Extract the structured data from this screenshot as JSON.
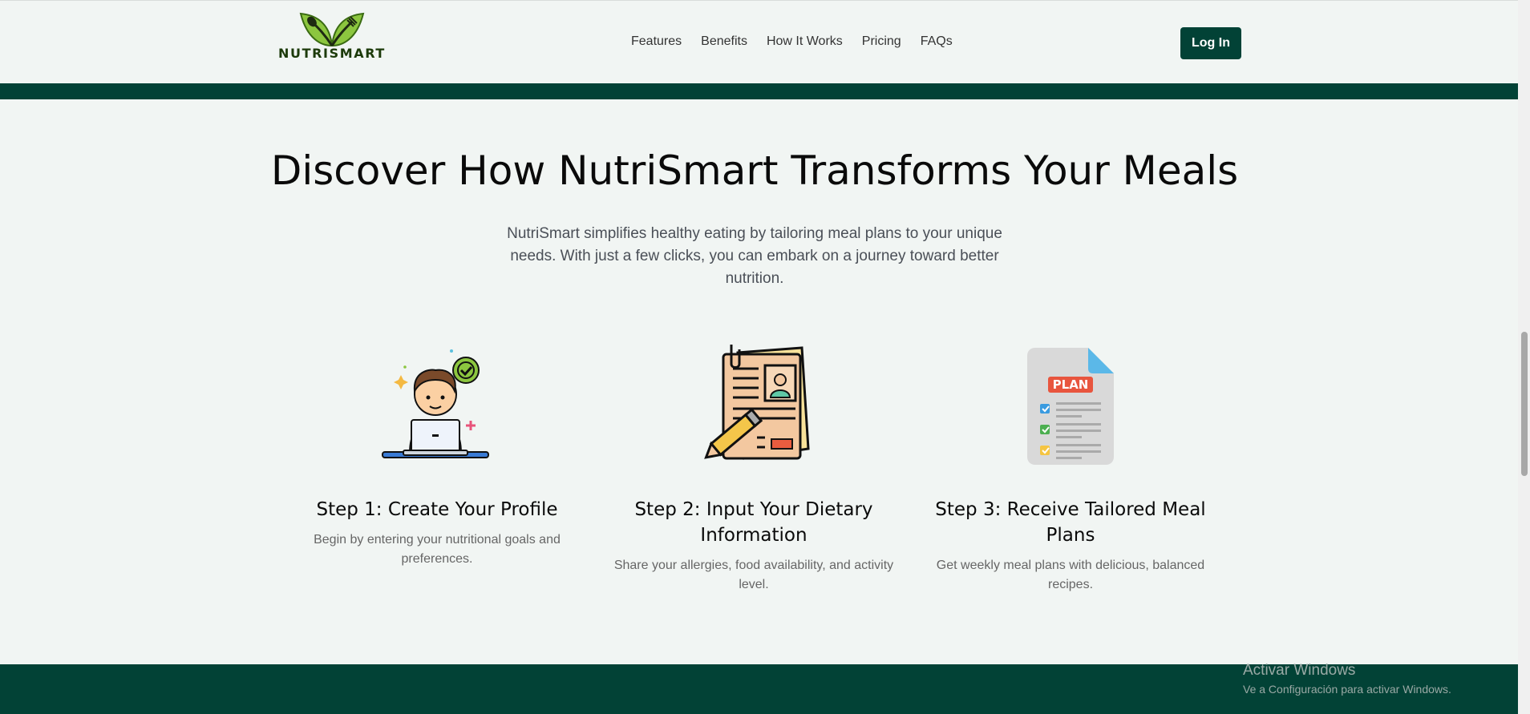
{
  "brand": {
    "name": "NUTRISMART"
  },
  "nav": [
    "Features",
    "Benefits",
    "How It Works",
    "Pricing",
    "FAQs"
  ],
  "header": {
    "login_label": "Log In"
  },
  "section": {
    "title": "Discover How NutriSmart Transforms Your Meals",
    "intro": "NutriSmart simplifies healthy eating by tailoring meal plans to your unique needs. With just a few clicks, you can embark on a journey toward better nutrition.",
    "steps": [
      {
        "title": "Step 1: Create Your Profile",
        "description": "Begin by entering your nutritional goals and preferences.",
        "icon": "person-laptop-icon"
      },
      {
        "title": "Step 2: Input Your Dietary Information",
        "description": "Share your allergies, food availability, and activity level.",
        "icon": "profile-document-icon"
      },
      {
        "title": "Step 3: Receive Tailored Meal Plans",
        "description": "Get weekly meal plans with delicious, balanced recipes.",
        "icon": "plan-document-icon",
        "icon_label": "PLAN"
      }
    ]
  },
  "watermark": {
    "line1": "Activar Windows",
    "line2": "Ve a Configuración para activar Windows."
  },
  "colors": {
    "primary": "#024236",
    "background": "#f1f5f3",
    "leaf": "#7cc242"
  }
}
